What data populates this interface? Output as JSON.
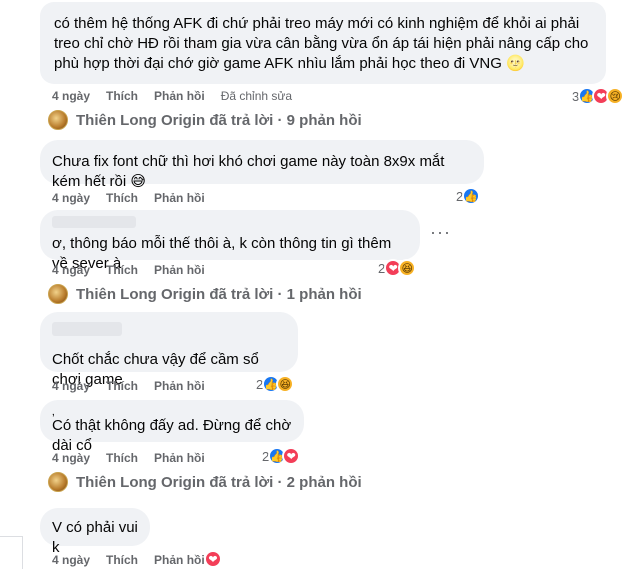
{
  "comments": [
    {
      "text": "có thêm hệ thống AFK đi chứ phải treo máy mới có kinh nghiệm để khỏi ai phải treo chỉ chờ HĐ rồi tham gia vừa cân bằng vừa ổn áp tái hiện phải nâng cấp cho phù hợp thời đại chớ giờ game AFK nhìu lắm phải học theo đi VNG 🌝",
      "time": "4 ngày",
      "like": "Thích",
      "reply": "Phản hồi",
      "edited": "Đã chỉnh sửa",
      "react_count": "3"
    },
    {
      "text": "Chưa fix font chữ thì hơi khó chơi game này toàn 8x9x mắt kém hết rồi 😅",
      "time": "4 ngày",
      "like": "Thích",
      "reply": "Phản hồi",
      "react_count": "2"
    },
    {
      "text": "ơ, thông báo mỗi thế thôi à, k còn thông tin gì thêm về sever à",
      "time": "4 ngày",
      "like": "Thích",
      "reply": "Phản hồi",
      "react_count": "2"
    },
    {
      "text": "Chốt chắc chưa vậy để cầm sổ chơi game",
      "time": "4 ngày",
      "like": "Thích",
      "reply": "Phản hồi",
      "react_count": "2"
    },
    {
      "text": "Có thật không đấy ad. Đừng để chờ dài cổ",
      "time": "4 ngày",
      "like": "Thích",
      "reply": "Phản hồi",
      "react_count": "2"
    },
    {
      "text": "V có phải vui k",
      "time": "4 ngày",
      "like": "Thích",
      "reply": "Phản hồi"
    }
  ],
  "replies": [
    {
      "text": "Thiên Long Origin đã trả lời · 9 phản hồi"
    },
    {
      "text": "Thiên Long Origin đã trả lời · 1 phản hồi"
    },
    {
      "text": "Thiên Long Origin đã trả lời · 2 phản hồi"
    }
  ],
  "more_glyph": "···",
  "comma_mark": "‚",
  "icons": {
    "like": "👍",
    "love": "❤",
    "haha": "😆",
    "sad": "😢"
  },
  "colors": {
    "bubble": "#f0f2f5",
    "meta": "#65676b",
    "like": "#1877f2",
    "love": "#f33e58"
  }
}
